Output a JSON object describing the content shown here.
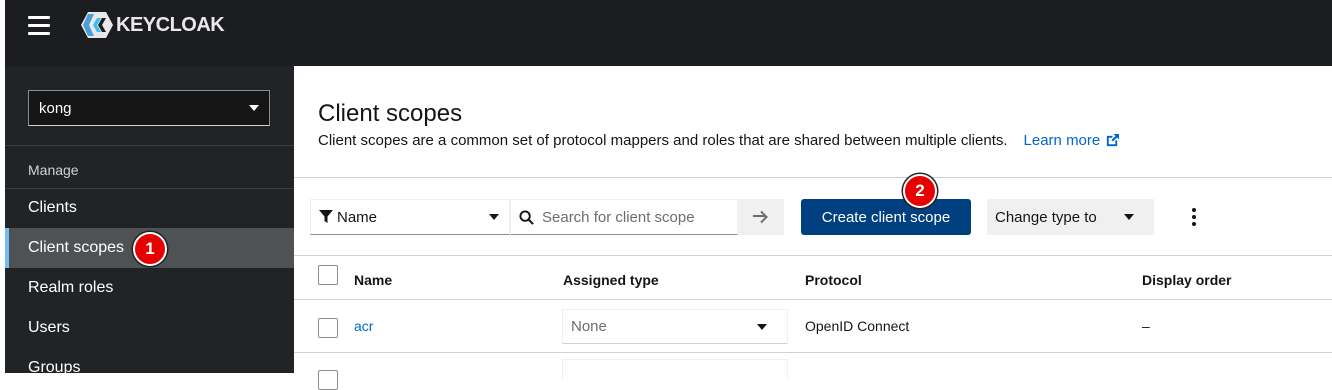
{
  "app": {
    "brand": "KEYCLOAK"
  },
  "sidebar": {
    "realm": "kong",
    "section": "Manage",
    "items": [
      {
        "label": "Clients"
      },
      {
        "label": "Client scopes",
        "active": true
      },
      {
        "label": "Realm roles"
      },
      {
        "label": "Users"
      },
      {
        "label": "Groups"
      }
    ]
  },
  "badges": {
    "first": "1",
    "second": "2"
  },
  "page": {
    "title": "Client scopes",
    "description": "Client scopes are a common set of protocol mappers and roles that are shared between multiple clients.",
    "learn_more": "Learn more"
  },
  "toolbar": {
    "filter_label": "Name",
    "search_placeholder": "Search for client scope",
    "create_label": "Create client scope",
    "change_type_label": "Change type to"
  },
  "table": {
    "headers": {
      "name": "Name",
      "assigned_type": "Assigned type",
      "protocol": "Protocol",
      "display_order": "Display order"
    },
    "rows": [
      {
        "name": "acr",
        "assigned_type": "None",
        "protocol": "OpenID Connect",
        "display_order": "–"
      }
    ]
  },
  "colors": {
    "primary": "#004080",
    "link": "#0066cc",
    "badge": "#e60000",
    "nav_active": "#4f5255"
  }
}
